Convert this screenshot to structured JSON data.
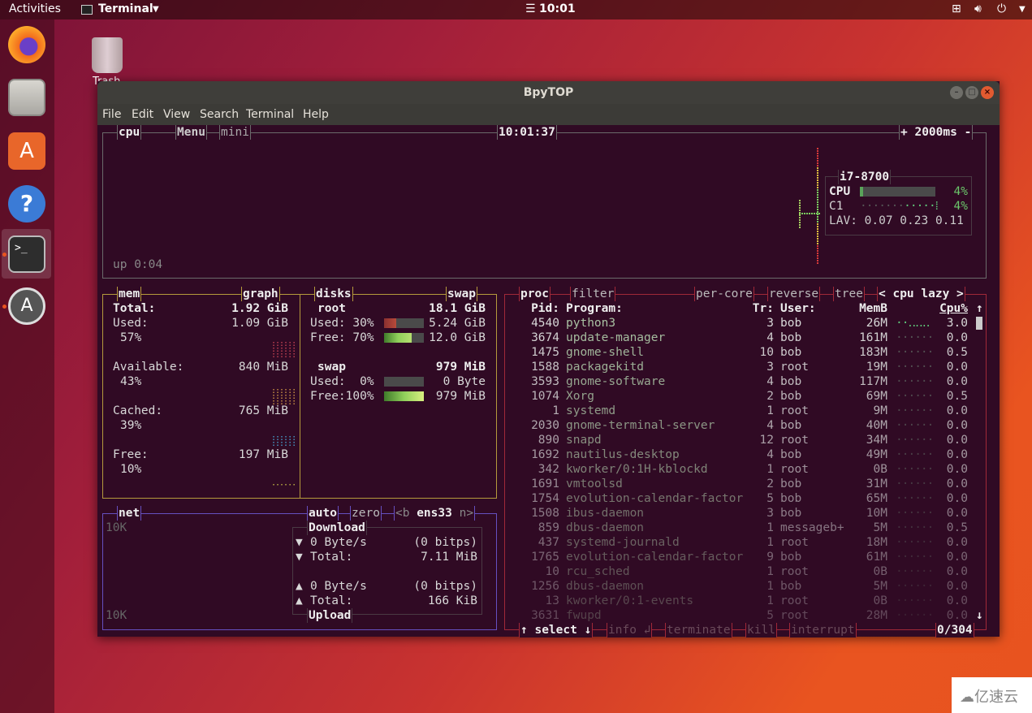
{
  "topbar": {
    "activities": "Activities",
    "app": "Terminal",
    "clock": "10:01",
    "icons": [
      "network-icon",
      "volume-icon",
      "power-icon",
      "chevron-down-icon"
    ]
  },
  "dock": {
    "items": [
      "firefox-icon",
      "files-icon",
      "software-icon",
      "help-icon",
      "terminal-icon",
      "updater-icon"
    ]
  },
  "desktop": {
    "trash_label": "Trash"
  },
  "window": {
    "title": "BpyTOP",
    "menu": [
      "File",
      "Edit",
      "View",
      "Search",
      "Terminal",
      "Help"
    ]
  },
  "cpu": {
    "title": "cpu",
    "menu": "Menu",
    "mini": "mini",
    "clock": "10:01:37",
    "interval": "+ 2000ms -",
    "uptime": "up 0:04",
    "model": "i7-8700",
    "cpu_label": "CPU",
    "cpu_pct": "4%",
    "cpu_value": 4,
    "core_label": "C1",
    "core_pct": "4%",
    "lav": "LAV: 0.07 0.23 0.11"
  },
  "mem": {
    "title": "mem",
    "graph": "graph",
    "rows": [
      {
        "label": "Total:",
        "value": "1.92 GiB"
      },
      {
        "label": "Used:",
        "value": "1.09 GiB",
        "pct": "57%"
      },
      {
        "label": "Available:",
        "value": "840 MiB",
        "pct": "43%"
      },
      {
        "label": "Cached:",
        "value": "765 MiB",
        "pct": "39%"
      },
      {
        "label": "Free:",
        "value": "197 MiB",
        "pct": "10%"
      }
    ]
  },
  "disks": {
    "title": "disks",
    "swap_toggle": "swap",
    "root": {
      "name": "root",
      "total": "18.1 GiB",
      "used_label": "Used: 30%",
      "used": "5.24 GiB",
      "used_pct": 30,
      "free_label": "Free: 70%",
      "free": "12.0 GiB",
      "free_pct": 70
    },
    "swap": {
      "name": "swap",
      "total": "979 MiB",
      "used_label": "Used:  0%",
      "used": "0 Byte",
      "used_pct": 0,
      "free_label": "Free:100%",
      "free": "979 MiB",
      "free_pct": 100
    }
  },
  "net": {
    "title": "net",
    "auto": "auto",
    "zero": "zero",
    "prev": "<b",
    "iface": "ens33",
    "next": "n>",
    "scale_top": "10K",
    "scale_bottom": "10K",
    "download_title": "Download",
    "dl_rate": "0 Byte/s",
    "dl_bits": "(0 bitps)",
    "dl_total_label": "Total:",
    "dl_total": "7.11 MiB",
    "upload_title": "Upload",
    "ul_rate": "0 Byte/s",
    "ul_bits": "(0 bitps)",
    "ul_total_label": "Total:",
    "ul_total": "166 KiB"
  },
  "proc": {
    "title": "proc",
    "filter": "filter",
    "per_core": "per-core",
    "reverse": "reverse",
    "tree": "tree",
    "sort": "< cpu lazy >",
    "headers": {
      "pid": "Pid:",
      "program": "Program:",
      "threads": "Tr:",
      "user": "User:",
      "mem": "MemB",
      "cpu": "Cpu%"
    },
    "rows": [
      [
        "4540",
        "python3",
        "3",
        "bob",
        "26M",
        "3.0"
      ],
      [
        "3674",
        "update-manager",
        "4",
        "bob",
        "161M",
        "0.0"
      ],
      [
        "1475",
        "gnome-shell",
        "10",
        "bob",
        "183M",
        "0.5"
      ],
      [
        "1588",
        "packagekitd",
        "3",
        "root",
        "19M",
        "0.0"
      ],
      [
        "3593",
        "gnome-software",
        "4",
        "bob",
        "117M",
        "0.0"
      ],
      [
        "1074",
        "Xorg",
        "2",
        "bob",
        "69M",
        "0.5"
      ],
      [
        "1",
        "systemd",
        "1",
        "root",
        "9M",
        "0.0"
      ],
      [
        "2030",
        "gnome-terminal-server",
        "4",
        "bob",
        "40M",
        "0.0"
      ],
      [
        "890",
        "snapd",
        "12",
        "root",
        "34M",
        "0.0"
      ],
      [
        "1692",
        "nautilus-desktop",
        "4",
        "bob",
        "49M",
        "0.0"
      ],
      [
        "342",
        "kworker/0:1H-kblockd",
        "1",
        "root",
        "0B",
        "0.0"
      ],
      [
        "1691",
        "vmtoolsd",
        "2",
        "bob",
        "31M",
        "0.0"
      ],
      [
        "1754",
        "evolution-calendar-factor",
        "5",
        "bob",
        "65M",
        "0.0"
      ],
      [
        "1508",
        "ibus-daemon",
        "3",
        "bob",
        "10M",
        "0.0"
      ],
      [
        "859",
        "dbus-daemon",
        "1",
        "messageb+",
        "5M",
        "0.5"
      ],
      [
        "437",
        "systemd-journald",
        "1",
        "root",
        "18M",
        "0.0"
      ],
      [
        "1765",
        "evolution-calendar-factor",
        "9",
        "bob",
        "61M",
        "0.0"
      ],
      [
        "10",
        "rcu_sched",
        "1",
        "root",
        "0B",
        "0.0"
      ],
      [
        "1256",
        "dbus-daemon",
        "1",
        "bob",
        "5M",
        "0.0"
      ],
      [
        "13",
        "kworker/0:1-events",
        "1",
        "root",
        "0B",
        "0.0"
      ],
      [
        "3631",
        "fwupd",
        "5",
        "root",
        "28M",
        "0.0"
      ]
    ],
    "footer": {
      "select": "↑ select ↓",
      "info": "info ↲",
      "terminate": "terminate",
      "kill": "kill",
      "interrupt": "interrupt",
      "count": "0/304"
    }
  },
  "colors": {
    "cpu_box": "#6b6b6b",
    "mem_box": "#b59a3c",
    "net_box": "#6650c0",
    "proc_box": "#a02838",
    "term_bg": "#300a24",
    "accent": "#e95420"
  },
  "watermark": "亿速云"
}
